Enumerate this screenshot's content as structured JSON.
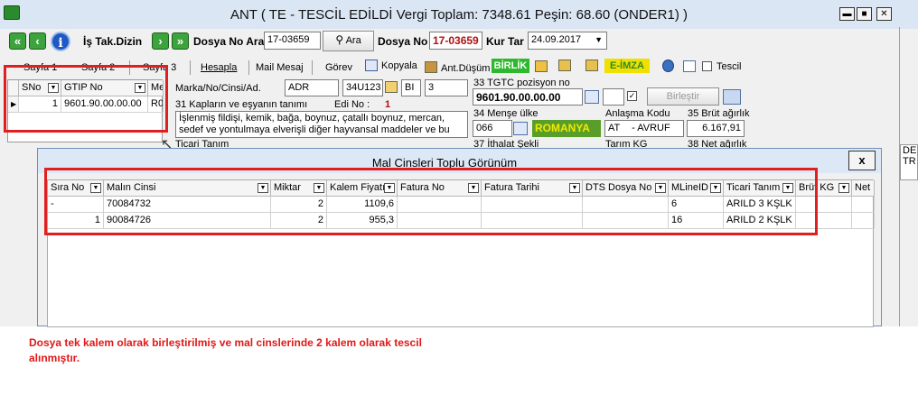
{
  "window": {
    "title": "ANT ( TE  - TESCİL EDİLDİ Vergi Toplam: 7348.61 Peşin: 68.60 (ONDER1) )",
    "minimize": "▬",
    "maximize": "■",
    "close": "✕"
  },
  "toolbar": {
    "is_tak_label": "İş Tak.Dizin",
    "dosya_no_ara_label": "Dosya No Ara",
    "search_value": "17-03659",
    "ara_button": "Ara",
    "dosya_no_label": "Dosya No",
    "dosya_no_value": "17-03659",
    "kur_tar_label": "Kur Tar",
    "kur_tar_value": "24.09.2017"
  },
  "tabs": {
    "sayfa1": "Sayfa 1",
    "sayfa2": "Sayfa 2",
    "sayfa3": "Sayfa 3",
    "hesapla": "Hesapla",
    "mail": "Mail Mesaj",
    "gorev": "Görev",
    "kopyala": "Kopyala",
    "ant_dusum": "Ant.Düşüm",
    "birlik": "BİRLİK",
    "e_imza": "E-İMZA",
    "tescil": "Tescil"
  },
  "left_grid": {
    "headers": [
      "SNo",
      "GTIP No",
      "Me"
    ],
    "row": {
      "sno": "1",
      "gtip": "9601.90.00.00.00",
      "me": "R0"
    }
  },
  "form": {
    "marka_label": "Marka/No/Cinsi/Ad.",
    "marka_value": "ADR",
    "code_value": "34U123",
    "bi_value": "BI",
    "three_value": "3",
    "kaplar_label": "31 Kapların ve eşyanın tanımı",
    "edi_label": "Edi No :",
    "edi_value": "1",
    "description": "İşlenmiş fildişi, kemik, bağa, boynuz, çatallı boynuz, mercan, sedef ve yontulmaya elverişli diğer hayvansal maddeler ve bu maddeler",
    "ticari_label": "Ticari Tanım",
    "tgtc_label": "33 TGTC pozisyon no",
    "tgtc_value": "9601.90.00.00.00",
    "birlestir": "Birleştir",
    "mense_label": "34 Menşe ülke",
    "mense_code": "066",
    "mense_name": "ROMANYA",
    "anlasma_label": "Anlaşma Kodu",
    "anlasma_value": "AT",
    "anlasma_desc": "- AVRUF",
    "brut_label": "35 Brüt ağırlık",
    "brut_value": "6.167,91",
    "ithalat_label": "37 İthalat Şekli",
    "tarim_label": "Tarım KG",
    "net_label": "38 Net ağırlık"
  },
  "dialog": {
    "title": "Mal Cinsleri Toplu Görünüm",
    "close": "x",
    "columns": [
      "Sıra No",
      "Malın Cinsi",
      "Miktar",
      "Kalem Fiyatı",
      "Fatura No",
      "Fatura Tarihi",
      "DTS Dosya No",
      "MLineID",
      "Ticari Tanım",
      "Brüt KG",
      "Net"
    ],
    "rows": [
      {
        "sira": "-",
        "cins": "70084732",
        "miktar": "2",
        "fiyat": "1109,6",
        "fatura_no": "",
        "fatura_tarihi": "",
        "dts": "",
        "mline": "6",
        "ticari": "ARILD 3 KŞLK",
        "brut": "",
        "net": ""
      },
      {
        "sira": "1",
        "cins": "90084726",
        "miktar": "2",
        "fiyat": "955,3",
        "fatura_no": "",
        "fatura_tarihi": "",
        "dts": "",
        "mline": "16",
        "ticari": "ARILD 2 KŞLK",
        "brut": "",
        "net": ""
      }
    ]
  },
  "right_peek": {
    "a": "DE",
    "b": "TR"
  },
  "annotation": {
    "line1": "Dosya tek kalem olarak birleştirilmiş ve  mal cinslerinde 2 kalem olarak tescil",
    "line2": "alınmıştır."
  },
  "colors": {
    "accent": "#e02020",
    "birlik_bg": "#2db82d",
    "eimza_bg": "#f0e000",
    "romanya_bg": "#5a9e2a"
  }
}
